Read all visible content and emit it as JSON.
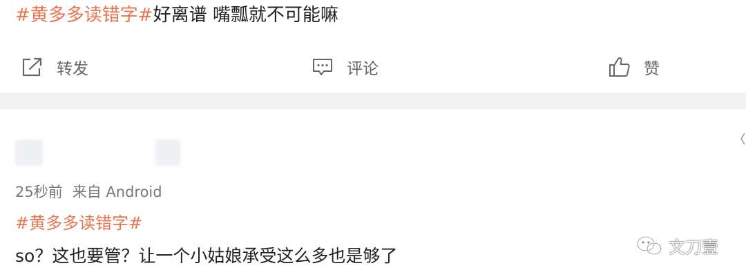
{
  "post1": {
    "hashtag": "#黄多多读错字#",
    "text": "好离谱 嘴瓢就不可能嘛"
  },
  "actions": {
    "repost_label": "转发",
    "comment_label": "评论",
    "like_label": "赞"
  },
  "post2": {
    "time": "25秒前",
    "source": "来自 Android",
    "hashtag": "#黄多多读错字#",
    "text": "so？这也要管？让一个小姑娘承受这么多也是够了"
  },
  "watermark": {
    "text": "文刀壹"
  },
  "colors": {
    "hashtag": "#eb7350",
    "text": "#222222",
    "meta": "#777777",
    "divider": "#f2f2f2"
  }
}
